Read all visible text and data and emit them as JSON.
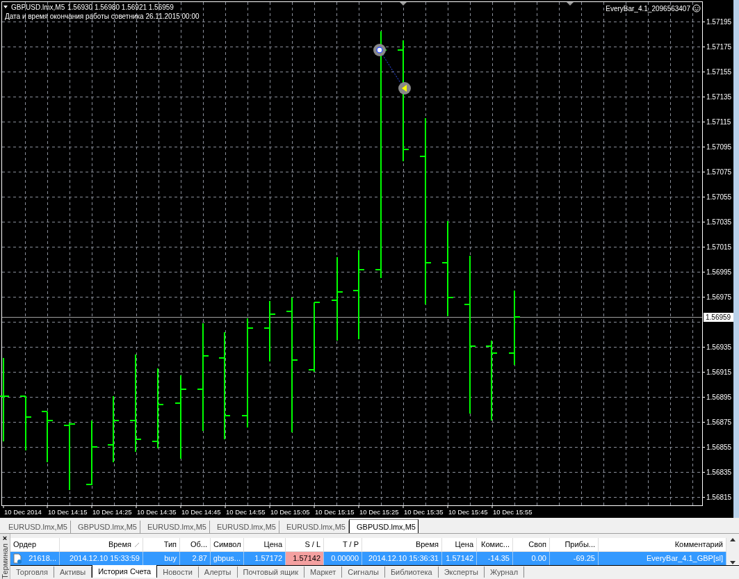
{
  "chart": {
    "symbol": "GBPUSD.lmx,M5",
    "ohlc": "1.56930 1.56980 1.56921 1.56959",
    "subtitle": "Дата и время окончания работы советника 26.11.2015 00:00",
    "expert": "EveryBar_4.1_2096563407",
    "current_price": "1.56959",
    "price_labels": [
      "1.57195",
      "1.57175",
      "1.57155",
      "1.57135",
      "1.57115",
      "1.57095",
      "1.57075",
      "1.57055",
      "1.57035",
      "1.57015",
      "1.56995",
      "1.56975",
      "1.56935",
      "1.56915",
      "1.56895",
      "1.56875",
      "1.56855",
      "1.56835",
      "1.56815"
    ],
    "time_labels": [
      "10 Dec 2014",
      "10 Dec 14:15",
      "10 Dec 14:25",
      "10 Dec 14:35",
      "10 Dec 14:45",
      "10 Dec 14:55",
      "10 Dec 15:05",
      "10 Dec 15:15",
      "10 Dec 15:25",
      "10 Dec 15:35",
      "10 Dec 15:45",
      "10 Dec 15:55"
    ]
  },
  "chart_tabs": [
    {
      "label": "EURUSD.lmx,M5",
      "selected": false
    },
    {
      "label": "GBPUSD.lmx,M5",
      "selected": false
    },
    {
      "label": "EURUSD.lmx,M5",
      "selected": false
    },
    {
      "label": "EURUSD.lmx,M5",
      "selected": false
    },
    {
      "label": "EURUSD.lmx,M5",
      "selected": false
    },
    {
      "label": "GBPUSD.lmx,M5",
      "selected": true
    }
  ],
  "terminal": {
    "title": "Терминал",
    "close": "×",
    "columns": [
      "Ордер",
      "Время",
      "Тип",
      "Об...",
      "Символ",
      "Цена",
      "S / L",
      "T / P",
      "Время",
      "Цена",
      "Комис...",
      "Своп",
      "Прибы...",
      "Комментарий"
    ],
    "rows": [
      {
        "selected": true,
        "cells": [
          {
            "text": "21618...",
            "flagged": false
          },
          {
            "text": "2014.12.10 15:33:59",
            "flagged": false
          },
          {
            "text": "buy",
            "flagged": false
          },
          {
            "text": "2.87",
            "flagged": false
          },
          {
            "text": "gbpus...",
            "flagged": false
          },
          {
            "text": "1.57172",
            "flagged": false
          },
          {
            "text": "1.57142",
            "flagged": true
          },
          {
            "text": "0.00000",
            "flagged": false
          },
          {
            "text": "2014.12.10 15:36:31",
            "flagged": false
          },
          {
            "text": "1.57142",
            "flagged": false
          },
          {
            "text": "-14.35",
            "flagged": false
          },
          {
            "text": "0.00",
            "flagged": false
          },
          {
            "text": "-69.25",
            "flagged": false
          },
          {
            "text": "EveryBar_4.1_GBP[sl]",
            "flagged": false
          }
        ]
      }
    ],
    "tabs": [
      {
        "label": "Торговля",
        "selected": false
      },
      {
        "label": "Активы",
        "selected": false
      },
      {
        "label": "История Счета",
        "selected": true
      },
      {
        "label": "Новости",
        "selected": false
      },
      {
        "label": "Алерты",
        "selected": false
      },
      {
        "label": "Почтовый ящик",
        "selected": false
      },
      {
        "label": "Маркет",
        "selected": false
      },
      {
        "label": "Сигналы",
        "selected": false
      },
      {
        "label": "Библиотека",
        "selected": false
      },
      {
        "label": "Эксперты",
        "selected": false
      },
      {
        "label": "Журнал",
        "selected": false
      }
    ]
  }
}
